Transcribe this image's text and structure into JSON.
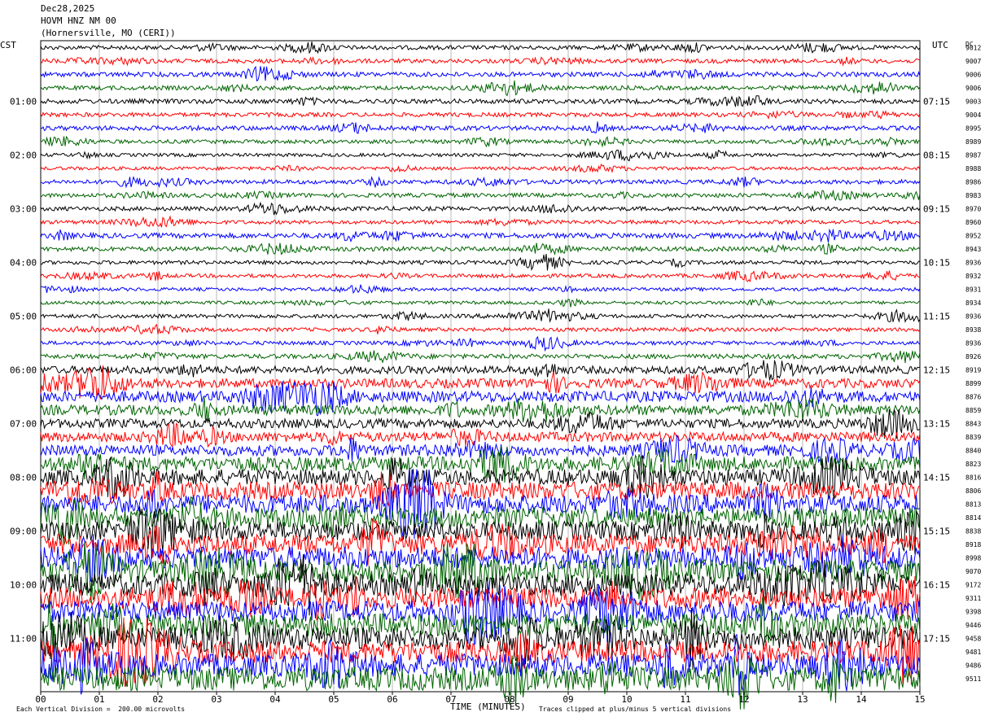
{
  "header": {
    "date": "Dec28,2025",
    "station": "HOVM HNZ NM 00",
    "location": "(Hornersville, MO (CERI))"
  },
  "left_zone_label": "CST",
  "right_zone_label": "UTC",
  "dc_label": "DC",
  "footer": {
    "scale_note": "Each Vertical Division =  200.00 microvolts",
    "xlabel": "TIME (MINUTES)",
    "clip_note": "Traces clipped at plus/minus 5 vertical divisions"
  },
  "chart_data": {
    "type": "line",
    "description_kind": "helicorder",
    "xlabel": "TIME (MINUTES)",
    "x_range": [
      0,
      15
    ],
    "x_ticks": [
      "00",
      "01",
      "02",
      "03",
      "04",
      "05",
      "06",
      "07",
      "08",
      "09",
      "10",
      "11",
      "12",
      "13",
      "14",
      "15"
    ],
    "rows_per_hour": 4,
    "minutes_per_row": 15,
    "trace_colors": [
      "#000000",
      "#ff0000",
      "#0000ff",
      "#006400"
    ],
    "left_time_labels": [
      "01:00",
      "02:00",
      "03:00",
      "04:00",
      "05:00",
      "06:00",
      "07:00",
      "08:00",
      "09:00",
      "10:00",
      "11:00"
    ],
    "right_time_labels": [
      "07:15",
      "08:15",
      "09:15",
      "10:15",
      "11:15",
      "12:15",
      "13:15",
      "14:15",
      "15:15",
      "16:15",
      "17:15"
    ],
    "dc_offsets": [
      "9012",
      "9007",
      "9006",
      "9006",
      "9003",
      "9004",
      "8995",
      "8989",
      "8987",
      "8988",
      "8986",
      "8983",
      "8970",
      "8960",
      "8952",
      "8943",
      "8936",
      "8932",
      "8931",
      "8934",
      "8936",
      "8938",
      "8936",
      "8926",
      "8919",
      "8899",
      "8876",
      "8859",
      "8843",
      "8839",
      "8840",
      "8823",
      "8816",
      "8806",
      "8813",
      "8814",
      "8838",
      "8918",
      "8998",
      "9070",
      "9172",
      "9311",
      "9398",
      "9446",
      "9458",
      "9481",
      "9486",
      "9511"
    ],
    "relative_amplitude": [
      1.0,
      1.0,
      1.1,
      1.0,
      1.1,
      1.0,
      1.1,
      0.9,
      0.8,
      0.8,
      1.0,
      1.0,
      1.0,
      0.9,
      1.2,
      1.1,
      0.9,
      0.9,
      0.8,
      0.8,
      0.9,
      0.9,
      0.9,
      1.1,
      1.8,
      2.2,
      2.6,
      2.4,
      2.2,
      2.3,
      2.6,
      3.4,
      3.8,
      4.2,
      4.5,
      4.8,
      4.6,
      4.8,
      5.2,
      5.4,
      5.2,
      5.0,
      5.0,
      5.4,
      5.4,
      5.2,
      5.4,
      5.6
    ]
  }
}
